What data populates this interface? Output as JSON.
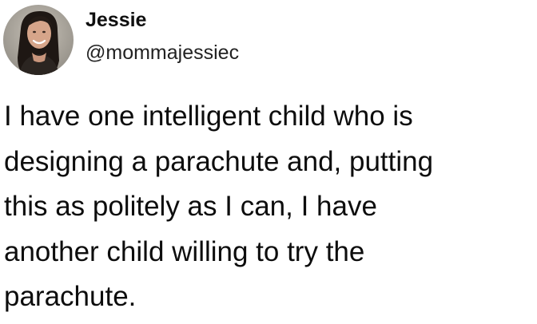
{
  "tweet": {
    "author": {
      "name": "Jessie",
      "handle": "@mommajessiec",
      "avatar_icon": "profile-photo"
    },
    "text": "I have one intelligent child who is\ndesigning a parachute and, putting\nthis as politely as I can, I have\nanother child willing to try the\nparachute."
  }
}
